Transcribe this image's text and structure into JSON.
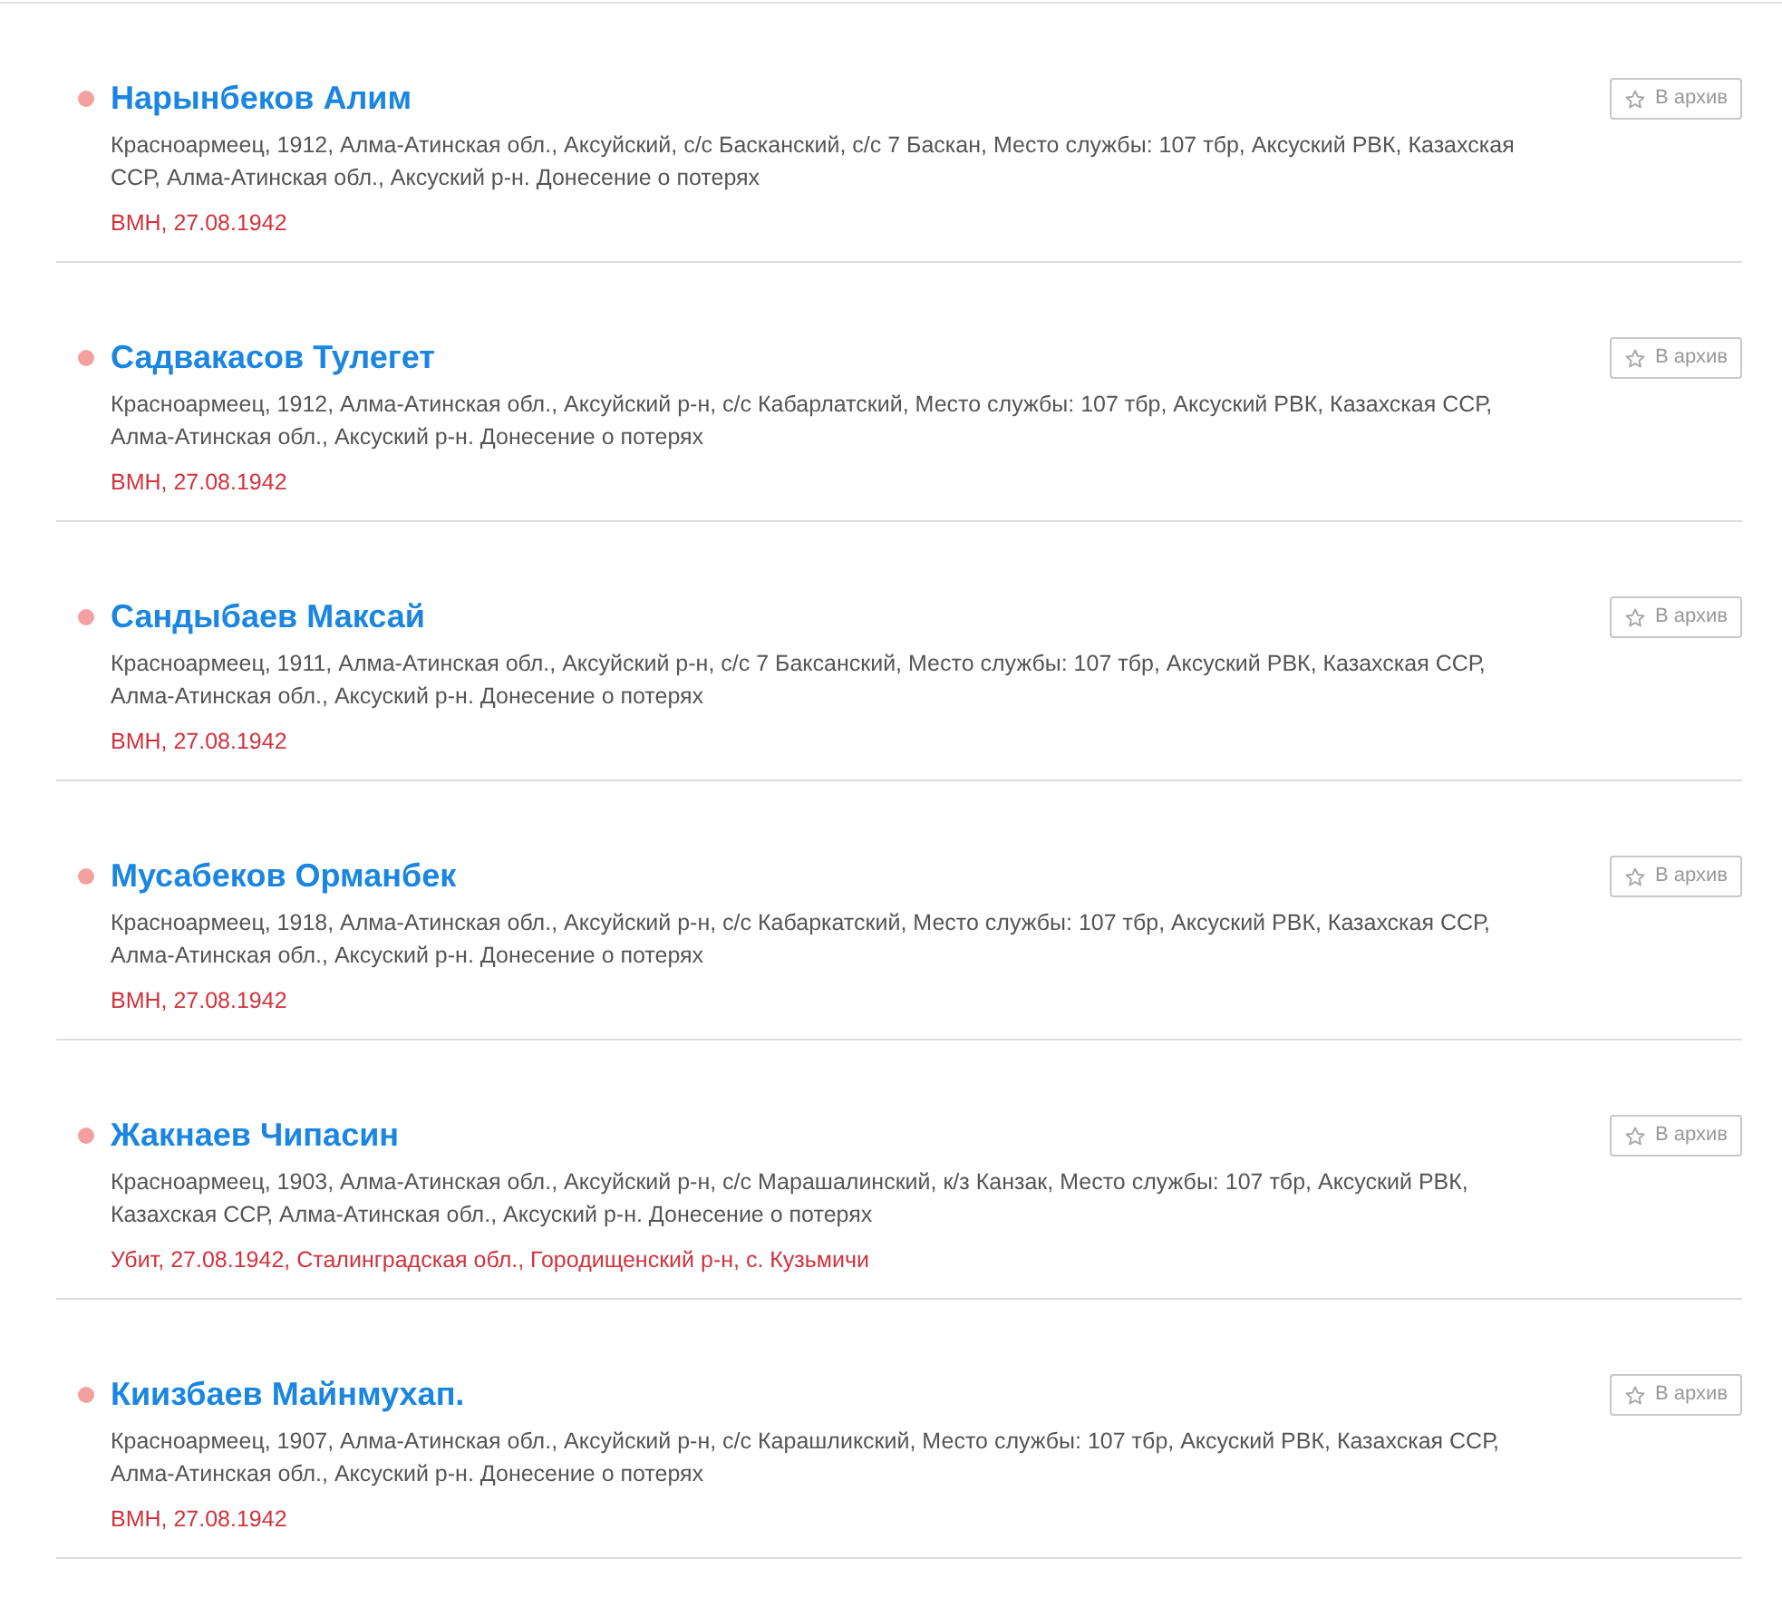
{
  "records": [
    {
      "name": "Нарынбеков Алим",
      "details": "Красноармеец, 1912, Алма-Атинская обл., Аксуйский, с/с Басканский, с/с 7 Баскан, Место службы: 107 тбр, Аксуский РВК, Казахская ССР, Алма-Атинская обл., Аксуский р-н. Донесение о потерях",
      "status": "ВМН, 27.08.1942",
      "archive_button": "В архив"
    },
    {
      "name": "Садвакасов Тулегет",
      "details": "Красноармеец, 1912, Алма-Атинская обл., Аксуйский р-н, с/с Кабарлатский, Место службы: 107 тбр, Аксуский РВК, Казахская ССР, Алма-Атинская обл., Аксуский р-н. Донесение о потерях",
      "status": "ВМН, 27.08.1942",
      "archive_button": "В архив"
    },
    {
      "name": "Сандыбаев Максай",
      "details": "Красноармеец, 1911, Алма-Атинская обл., Аксуйский р-н, с/с 7 Баксанский, Место службы: 107 тбр, Аксуский РВК, Казахская ССР, Алма-Атинская обл., Аксуский р-н. Донесение о потерях",
      "status": "ВМН, 27.08.1942",
      "archive_button": "В архив"
    },
    {
      "name": "Мусабеков Орманбек",
      "details": "Красноармеец, 1918, Алма-Атинская обл., Аксуйский р-н, с/с Кабаркатский, Место службы: 107 тбр, Аксуский РВК, Казахская ССР, Алма-Атинская обл., Аксуский р-н. Донесение о потерях",
      "status": "ВМН, 27.08.1942",
      "archive_button": "В архив"
    },
    {
      "name": "Жакнаев Чипасин",
      "details": "Красноармеец, 1903, Алма-Атинская обл., Аксуйский р-н, с/с Марашалинский, к/з Канзак, Место службы: 107 тбр, Аксуский РВК, Казахская ССР, Алма-Атинская обл., Аксуский р-н. Донесение о потерях",
      "status": "Убит, 27.08.1942, Сталинградская обл., Городищенский р-н, с. Кузьмичи",
      "archive_button": "В архив"
    },
    {
      "name": "Киизбаев Майнмухап.",
      "details": "Красноармеец, 1907, Алма-Атинская обл., Аксуйский р-н, с/с Карашликский, Место службы: 107 тбр, Аксуский РВК, Казахская ССР, Алма-Атинская обл., Аксуский р-н. Донесение о потерях",
      "status": "ВМН, 27.08.1942",
      "archive_button": "В архив"
    }
  ]
}
